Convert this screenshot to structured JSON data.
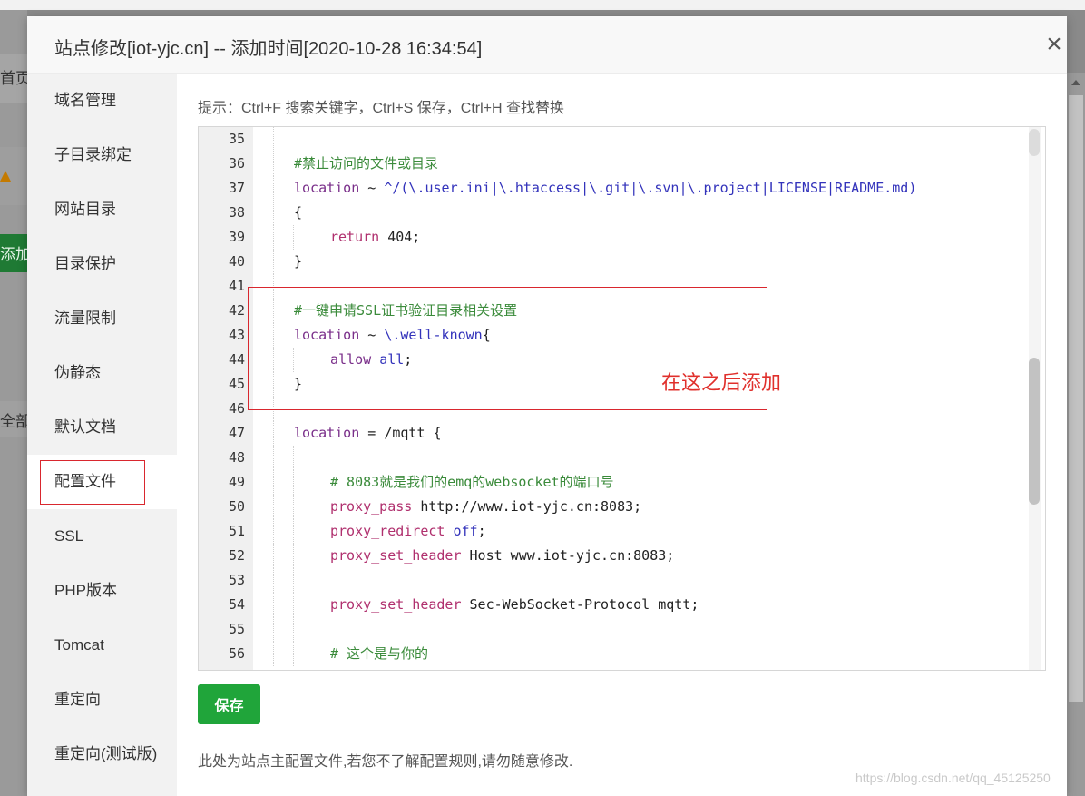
{
  "background": {
    "fragments": [
      "首页",
      "添加站",
      "全部分"
    ]
  },
  "modal": {
    "title": "站点修改[iot-yjc.cn] -- 添加时间[2020-10-28 16:34:54]",
    "close_icon": "×",
    "close_icon_name": "close-icon"
  },
  "sidebar": {
    "items": [
      {
        "label": "域名管理"
      },
      {
        "label": "子目录绑定"
      },
      {
        "label": "网站目录"
      },
      {
        "label": "目录保护"
      },
      {
        "label": "流量限制"
      },
      {
        "label": "伪静态"
      },
      {
        "label": "默认文档"
      },
      {
        "label": "配置文件",
        "active": true
      },
      {
        "label": "SSL"
      },
      {
        "label": "PHP版本"
      },
      {
        "label": "Tomcat"
      },
      {
        "label": "重定向"
      },
      {
        "label": "重定向(测试版)"
      }
    ]
  },
  "content": {
    "hint": "提示：Ctrl+F 搜索关键字，Ctrl+S 保存，Ctrl+H 查找替换",
    "annotation": "在这之后添加",
    "save_label": "保存",
    "note": "此处为站点主配置文件,若您不了解配置规则,请勿随意修改."
  },
  "editor": {
    "lines": [
      {
        "n": "35"
      },
      {
        "n": "36",
        "comment": "#禁止访问的文件或目录"
      },
      {
        "n": "37",
        "kw": "location",
        "rest": " ~ ",
        "blue": "^/(\\.user.ini|\\.htaccess|\\.git|\\.svn|\\.project|LICENSE|README.md)"
      },
      {
        "n": "38",
        "text": "{"
      },
      {
        "n": "39",
        "kw": "return",
        "rest": " 404;"
      },
      {
        "n": "40",
        "text": "}"
      },
      {
        "n": "41"
      },
      {
        "n": "42",
        "comment": "#一键申请SSL证书验证目录相关设置"
      },
      {
        "n": "43",
        "kw": "location",
        "rest": " ~ ",
        "blue": "\\.well-known",
        "after": "{"
      },
      {
        "n": "44",
        "kw": "allow",
        "rest": " ",
        "blue": "all",
        "after": ";"
      },
      {
        "n": "45",
        "text": "}"
      },
      {
        "n": "46"
      },
      {
        "n": "47",
        "kw": "location",
        "rest": " = /mqtt {"
      },
      {
        "n": "48"
      },
      {
        "n": "49",
        "comment": "# 8083就是我们的emq的websocket的端口号"
      },
      {
        "n": "50",
        "kw": "proxy_pass",
        "rest": " http://www.iot-yjc.cn:8083;"
      },
      {
        "n": "51",
        "kw": "proxy_redirect",
        "rest": " ",
        "blue": "off",
        "after": ";"
      },
      {
        "n": "52",
        "kw": "proxy_set_header",
        "rest": " Host www.iot-yjc.cn:8083;"
      },
      {
        "n": "53"
      },
      {
        "n": "54",
        "kw": "proxy_set_header",
        "rest": " Sec-WebSocket-Protocol mqtt;"
      },
      {
        "n": "55"
      },
      {
        "n": "56",
        "comment": "# 这个是与你的"
      }
    ]
  },
  "watermark": "https://blog.csdn.net/qq_45125250",
  "colors": {
    "accent_green": "#20a53a",
    "annotation_red": "#d9272e"
  }
}
